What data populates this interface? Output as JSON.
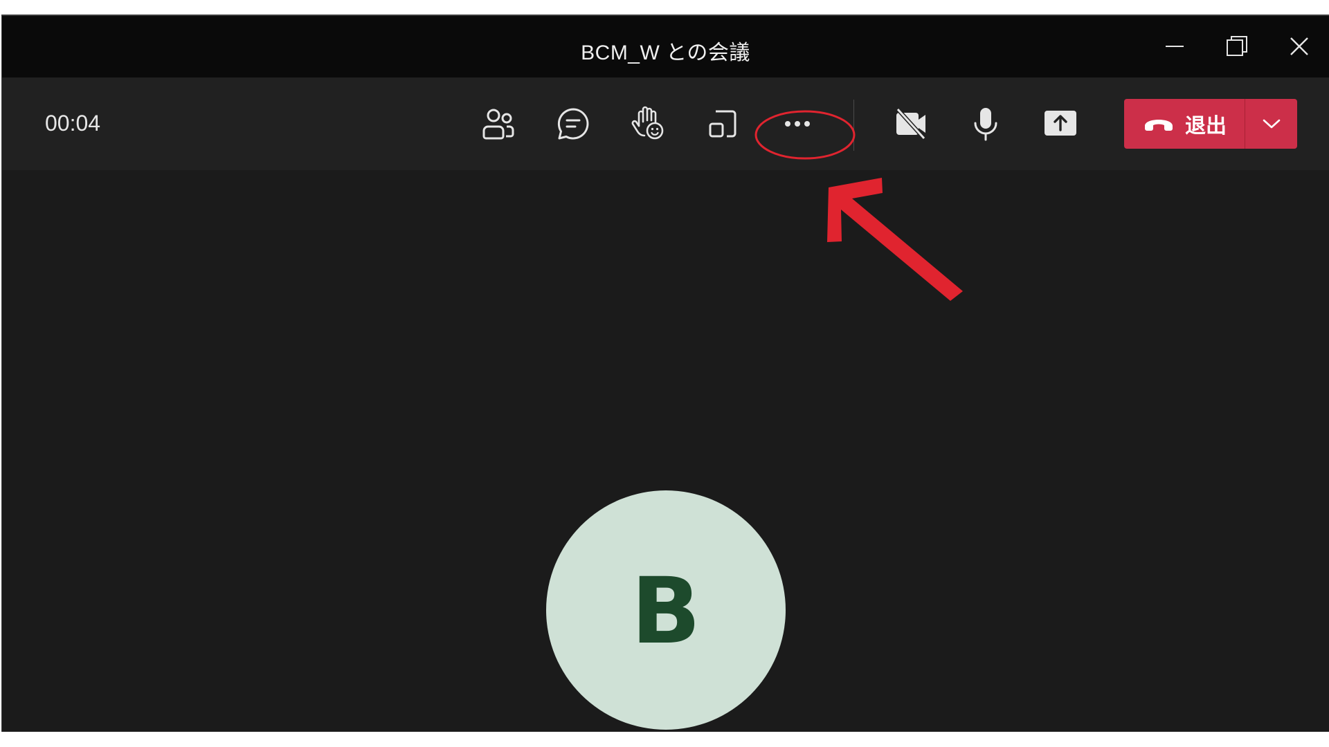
{
  "window": {
    "title": "BCM_W との会議",
    "controls": [
      {
        "name": "minimize-icon"
      },
      {
        "name": "restore-icon"
      },
      {
        "name": "close-icon"
      }
    ]
  },
  "toolbar": {
    "timer": "00:04",
    "buttons": [
      {
        "name": "participants-icon"
      },
      {
        "name": "chat-icon"
      },
      {
        "name": "reactions-icon"
      },
      {
        "name": "rooms-icon"
      },
      {
        "name": "more-actions-icon"
      },
      {
        "name": "camera-off-icon"
      },
      {
        "name": "microphone-icon"
      },
      {
        "name": "share-screen-icon"
      }
    ],
    "leave": {
      "label": "退出",
      "color": "#cc2f49"
    }
  },
  "participant": {
    "initial": "B",
    "avatar_color": "#cfe1d6",
    "initial_color": "#1d4a2c"
  },
  "annotation": {
    "color": "#e0242f"
  }
}
